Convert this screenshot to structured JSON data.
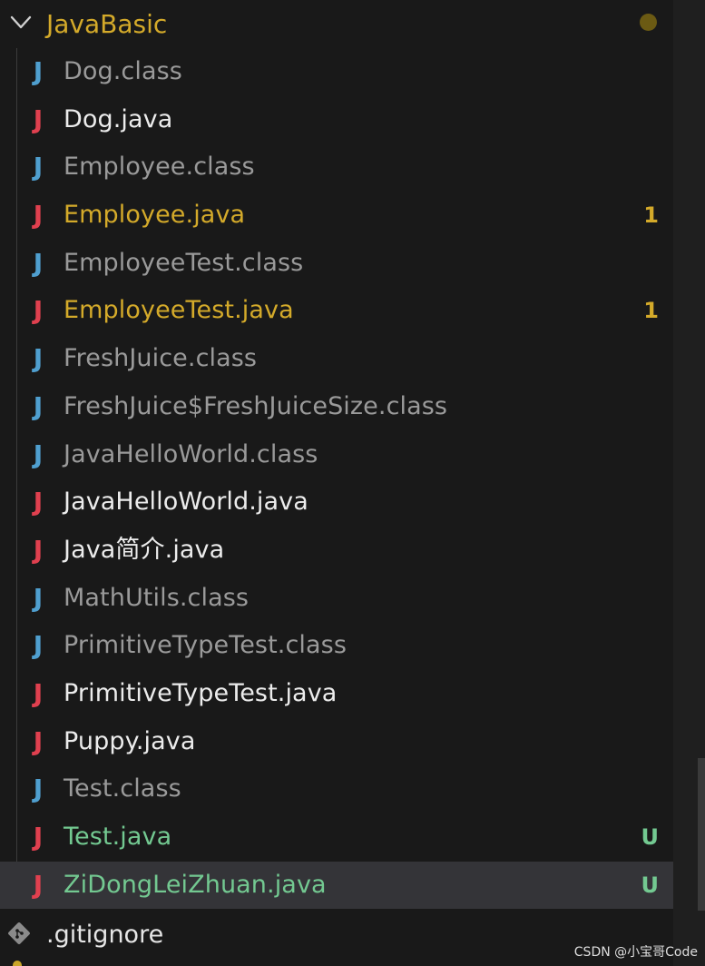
{
  "folder": {
    "name": "JavaBasic",
    "chevron_icon": "chevron-down-icon",
    "modified_dot_color": "#6b5a13"
  },
  "colors": {
    "java_icon_red": "#e0404f",
    "class_icon_blue": "#4f9fcf",
    "text_class": "#9a9a9a",
    "text_normal": "#ececec",
    "text_warning": "#d4aa2a",
    "text_untracked": "#73c991",
    "selected_bg": "#343438"
  },
  "files": [
    {
      "icon": "J",
      "icon_type": "class",
      "name": "Dog.class",
      "status": "class",
      "badge": ""
    },
    {
      "icon": "J",
      "icon_type": "java",
      "name": "Dog.java",
      "status": "normal",
      "badge": ""
    },
    {
      "icon": "J",
      "icon_type": "class",
      "name": "Employee.class",
      "status": "class",
      "badge": ""
    },
    {
      "icon": "J",
      "icon_type": "java",
      "name": "Employee.java",
      "status": "warning",
      "badge": "1"
    },
    {
      "icon": "J",
      "icon_type": "class",
      "name": "EmployeeTest.class",
      "status": "class",
      "badge": ""
    },
    {
      "icon": "J",
      "icon_type": "java",
      "name": "EmployeeTest.java",
      "status": "warning",
      "badge": "1"
    },
    {
      "icon": "J",
      "icon_type": "class",
      "name": "FreshJuice.class",
      "status": "class",
      "badge": ""
    },
    {
      "icon": "J",
      "icon_type": "class",
      "name": "FreshJuice$FreshJuiceSize.class",
      "status": "class",
      "badge": ""
    },
    {
      "icon": "J",
      "icon_type": "class",
      "name": "JavaHelloWorld.class",
      "status": "class",
      "badge": ""
    },
    {
      "icon": "J",
      "icon_type": "java",
      "name": "JavaHelloWorld.java",
      "status": "normal",
      "badge": ""
    },
    {
      "icon": "J",
      "icon_type": "java",
      "name": "Java简介.java",
      "status": "normal",
      "badge": ""
    },
    {
      "icon": "J",
      "icon_type": "class",
      "name": "MathUtils.class",
      "status": "class",
      "badge": ""
    },
    {
      "icon": "J",
      "icon_type": "class",
      "name": "PrimitiveTypeTest.class",
      "status": "class",
      "badge": ""
    },
    {
      "icon": "J",
      "icon_type": "java",
      "name": "PrimitiveTypeTest.java",
      "status": "normal",
      "badge": ""
    },
    {
      "icon": "J",
      "icon_type": "java",
      "name": "Puppy.java",
      "status": "normal",
      "badge": ""
    },
    {
      "icon": "J",
      "icon_type": "class",
      "name": "Test.class",
      "status": "class",
      "badge": ""
    },
    {
      "icon": "J",
      "icon_type": "java",
      "name": "Test.java",
      "status": "untracked",
      "badge": "U"
    },
    {
      "icon": "J",
      "icon_type": "java",
      "name": "ZiDongLeiZhuan.java",
      "status": "untracked",
      "badge": "U",
      "selected": true
    }
  ],
  "gitignore": {
    "name": ".gitignore",
    "icon": "git-icon"
  },
  "watermark": "CSDN @小宝哥Code"
}
